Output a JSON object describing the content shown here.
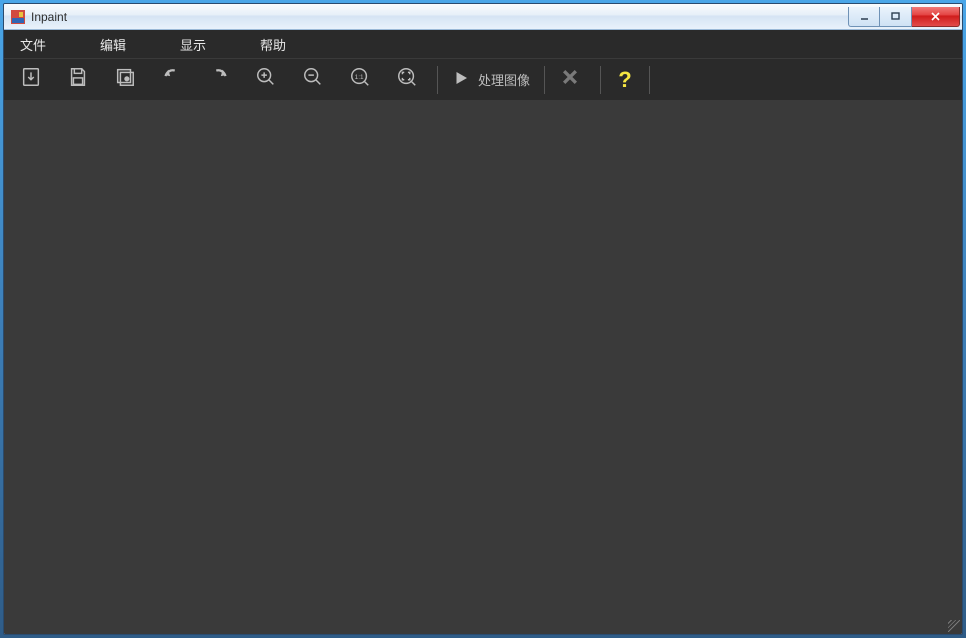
{
  "window": {
    "title": "Inpaint"
  },
  "menu": {
    "file": "文件",
    "edit": "编辑",
    "view": "显示",
    "help": "帮助"
  },
  "toolbar": {
    "process_label": "处理图像",
    "help_symbol": "?"
  }
}
